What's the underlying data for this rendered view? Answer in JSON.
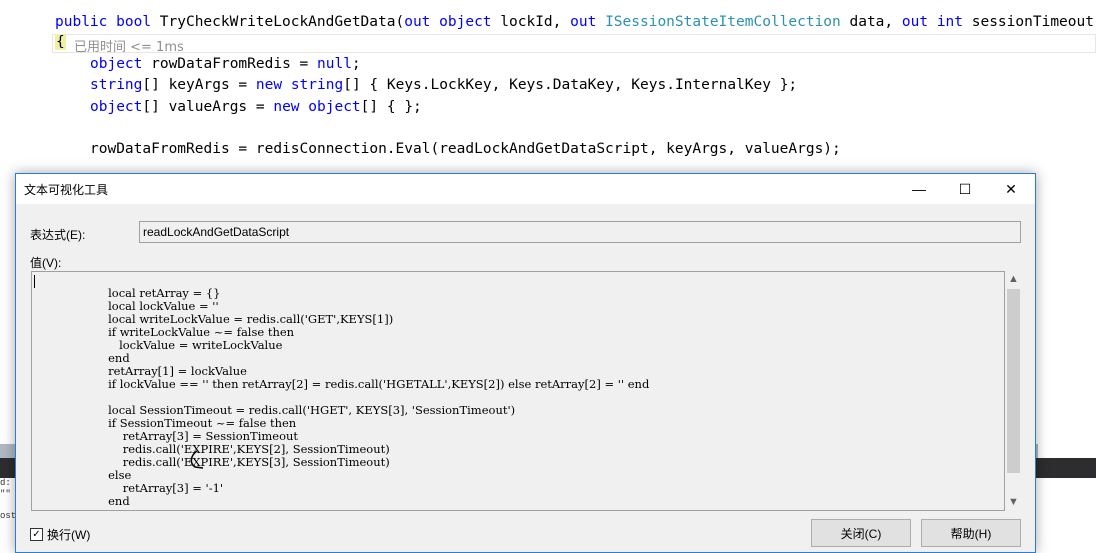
{
  "editor": {
    "line1": {
      "kw1": "public",
      "kw2": "bool",
      "name": " TryCheckWriteLockAndGetData(",
      "kw3": "out",
      "kw4": "object",
      "p1": " lockId, ",
      "kw5": "out",
      "ty1": "ISessionStateItemCollection",
      "p2": " data, ",
      "kw6": "out",
      "kw7": "int",
      "p3": " sessionTimeout)"
    },
    "brace": "{",
    "hint": "已用时间 <= 1ms",
    "line3": {
      "kw": "object",
      "rest": " rowDataFromRedis = ",
      "kw2": "null",
      "end": ";"
    },
    "line4": {
      "kw": "string",
      "rest": "[] keyArgs = ",
      "kw2": "new",
      "sp": " ",
      "kw3": "string",
      "end": "[] { Keys.LockKey, Keys.DataKey, Keys.InternalKey };"
    },
    "line5": {
      "kw": "object",
      "rest": "[] valueArgs = ",
      "kw2": "new",
      "sp": " ",
      "kw3": "object",
      "end": "[] { };"
    },
    "line7": "rowDataFromRedis = redisConnection.Eval(readLockAndGetDataScript, keyArgs, valueArgs);",
    "left_panel": "d:\n\"\"\n\nost\n"
  },
  "dialog": {
    "title": "文本可视化工具",
    "minimize": "—",
    "maximize": "☐",
    "close": "✕",
    "expression_label": "表达式(E):",
    "expression_value": "readLockAndGetDataScript",
    "value_label": "值(V):",
    "value_text": "\n                    local retArray = {}\n                    local lockValue = ''\n                    local writeLockValue = redis.call('GET',KEYS[1])\n                    if writeLockValue ~= false then\n                       lockValue = writeLockValue\n                    end\n                    retArray[1] = lockValue\n                    if lockValue == '' then retArray[2] = redis.call('HGETALL',KEYS[2]) else retArray[2] = '' end\n\n                    local SessionTimeout = redis.call('HGET', KEYS[3], 'SessionTimeout')\n                    if SessionTimeout ~= false then\n                        retArray[3] = SessionTimeout\n                        redis.call('EXPIRE',KEYS[2], SessionTimeout)\n                        redis.call('EXPIRE',KEYS[3], SessionTimeout)\n                    else\n                        retArray[3] = '-1'\n                    end",
    "wrap_label": "换行(W)",
    "wrap_checked": true,
    "close_button": "关闭(C)",
    "help_button": "帮助(H)",
    "scroll_up": "▲",
    "scroll_down": "▼"
  }
}
